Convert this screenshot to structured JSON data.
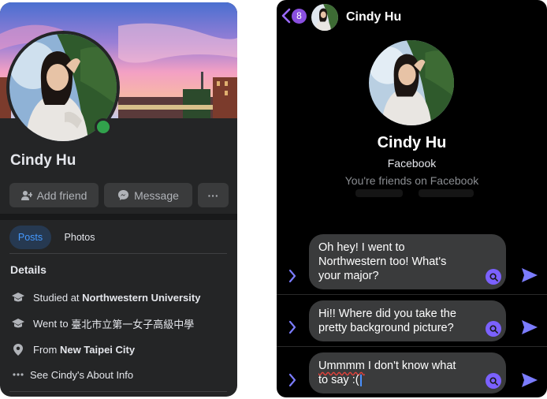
{
  "facebook": {
    "name": "Cindy Hu",
    "online": true,
    "buttons": {
      "add_friend": "Add friend",
      "message": "Message",
      "more": "···"
    },
    "tabs": {
      "posts": "Posts",
      "photos": "Photos"
    },
    "details_title": "Details",
    "details": {
      "studied_prefix": "Studied at ",
      "studied_school": "Northwestern University",
      "went_prefix": "Went to ",
      "went_school": "臺北市立第一女子高級中學",
      "from_prefix": "From ",
      "from_city": "New Taipei City",
      "about": "See Cindy's About Info"
    },
    "colors": {
      "card_bg": "#242526",
      "accent_tab": "#4599ff",
      "online": "#31a24c"
    }
  },
  "messenger": {
    "unread_count": "8",
    "header_name": "Cindy Hu",
    "profile_name": "Cindy Hu",
    "profile_platform": "Facebook",
    "friends_status": "You're friends on Facebook",
    "drafts": [
      {
        "text": "Oh hey! I went to\nNorthwestern too! What's\nyour major?"
      },
      {
        "text": "Hi!! Where did you take the\npretty background picture?"
      },
      {
        "misspelled": "Ummmm",
        "rest": " I don't know what\nto say :("
      }
    ],
    "colors": {
      "accent": "#8a4fe0",
      "send": "#7b7cff"
    }
  }
}
